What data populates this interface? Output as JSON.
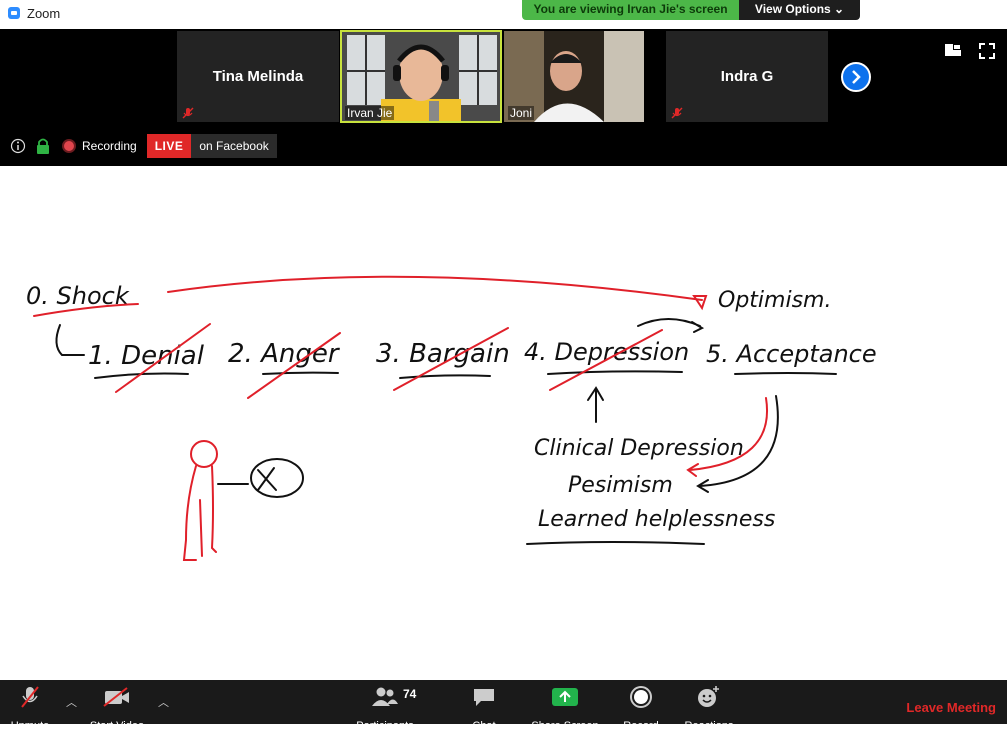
{
  "app": {
    "title": "Zoom"
  },
  "banner": {
    "message": "You are viewing Irvan Jie's screen",
    "view_options": "View Options ⌄"
  },
  "participants": [
    {
      "name": "Tina Melinda",
      "type": "name-only",
      "muted": true
    },
    {
      "name": "Irvan Jie",
      "type": "video",
      "active_speaker": true
    },
    {
      "name": "Joni",
      "type": "video"
    },
    {
      "name": "Indra G",
      "type": "name-only",
      "muted": true
    }
  ],
  "status": {
    "recording": "Recording",
    "live": "LIVE",
    "live_target": "on Facebook"
  },
  "whiteboard": {
    "texts": [
      "0. Shock",
      "1. Denial",
      "2. Anger",
      "3. Bargain",
      "4. Depression",
      "5. Acceptance",
      "Optimism.",
      "Clinical Depression",
      "Pesimism",
      "Learned helplessness"
    ]
  },
  "toolbar": {
    "unmute": "Unmute",
    "start_video": "Start Video",
    "participants": "Participants",
    "participants_count": "74",
    "chat": "Chat",
    "share_screen": "Share Screen",
    "record": "Record",
    "reactions": "Reactions",
    "leave": "Leave Meeting"
  },
  "colors": {
    "brand": "#2d8cff",
    "banner_green": "#4cb748",
    "live_red": "#e02828",
    "ink_red": "#e0202a",
    "ink_black": "#111111"
  }
}
